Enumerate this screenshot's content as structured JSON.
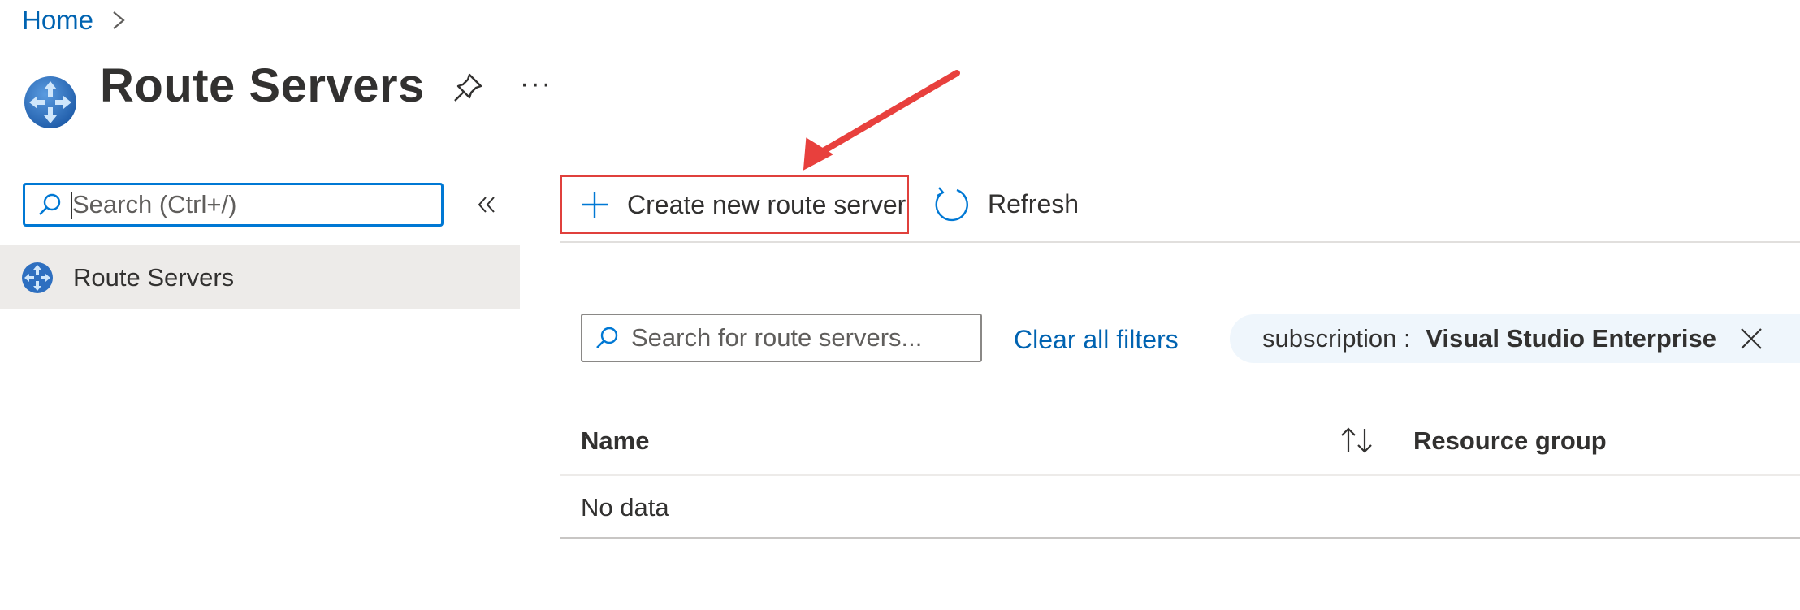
{
  "breadcrumb": {
    "home": "Home"
  },
  "page": {
    "title": "Route Servers",
    "more": "···"
  },
  "sidebar": {
    "search_placeholder": "Search (Ctrl+/)",
    "items": [
      {
        "label": "Route Servers",
        "selected": true
      }
    ]
  },
  "toolbar": {
    "create_label": "Create new route server",
    "refresh_label": "Refresh"
  },
  "filters": {
    "search_placeholder": "Search for route servers...",
    "clear_label": "Clear all filters",
    "pill_key": "subscription : ",
    "pill_value": "Visual Studio Enterprise"
  },
  "table": {
    "columns": [
      "Name",
      "Resource group"
    ],
    "empty_text": "No data"
  },
  "colors": {
    "accent": "#0078d4",
    "link": "#0063b1",
    "highlight_box": "#e0403c",
    "selected_nav": "#edebe9",
    "pill_bg": "#eff6fc"
  },
  "icons": [
    "chevron-right-icon",
    "route-server-icon",
    "pin-icon",
    "more-icon",
    "search-icon",
    "double-chevron-left-icon",
    "plus-icon",
    "refresh-icon",
    "sort-icon",
    "close-icon",
    "annotation-arrow"
  ]
}
